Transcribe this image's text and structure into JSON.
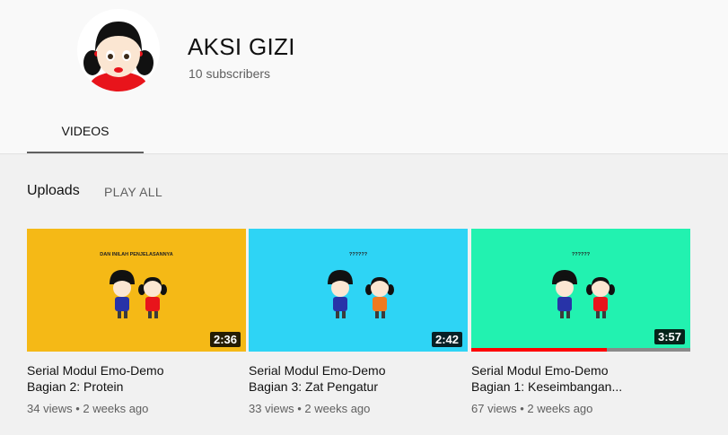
{
  "channel": {
    "name": "AKSI GIZI",
    "subscribers": "10 subscribers"
  },
  "tabs": [
    {
      "label": "VIDEOS",
      "active": true
    }
  ],
  "section": {
    "title": "Uploads",
    "play_all": "PLAY ALL"
  },
  "videos": [
    {
      "title_line1": "Serial Modul Emo-Demo",
      "title_line2": "Bagian 2: Protein",
      "duration": "2:36",
      "views": "34 views",
      "age": "2 weeks ago",
      "thumb_caption": "DAN INILAH PENJELASANNYA",
      "thumb_bg": "#f5b916",
      "watched": 0
    },
    {
      "title_line1": "Serial Modul Emo-Demo",
      "title_line2": "Bagian 3: Zat Pengatur",
      "duration": "2:42",
      "views": "33 views",
      "age": "2 weeks ago",
      "thumb_caption": "??????",
      "thumb_bg": "#2ed4f5",
      "watched": 0
    },
    {
      "title_line1": "Serial Modul Emo-Demo",
      "title_line2": "Bagian 1: Keseimbangan...",
      "duration": "3:57",
      "views": "67 views",
      "age": "2 weeks ago",
      "thumb_caption": "??????",
      "thumb_bg": "#22f2b0",
      "watched": 0.62
    }
  ],
  "meta_separator": "•",
  "icons": {
    "avatar": "cartoon-girl-avatar"
  }
}
